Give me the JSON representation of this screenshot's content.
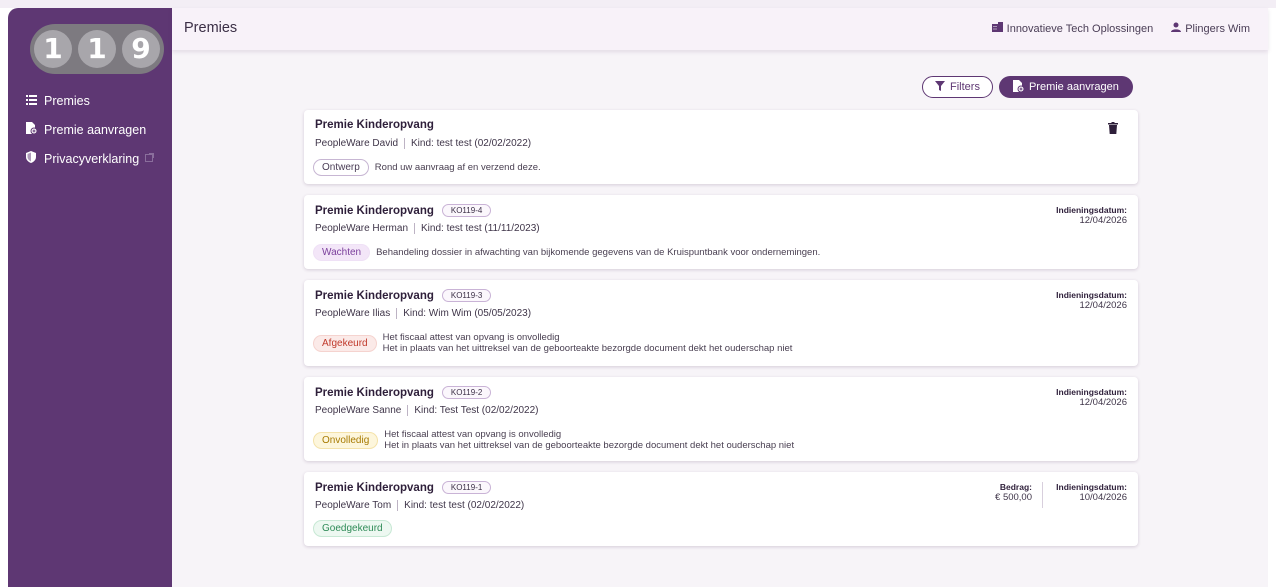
{
  "logo": {
    "digits": [
      "1",
      "1",
      "9"
    ]
  },
  "sidebar": {
    "items": [
      {
        "label": "Premies",
        "icon": "list-icon"
      },
      {
        "label": "Premie aanvragen",
        "icon": "file-add-icon"
      },
      {
        "label": "Privacyverklaring",
        "icon": "shield-icon",
        "external": true
      }
    ]
  },
  "header": {
    "title": "Premies",
    "organization": "Innovatieve Tech Oplossingen",
    "user": "Plingers Wim"
  },
  "actions": {
    "filters_label": "Filters",
    "request_label": "Premie aanvragen"
  },
  "colors": {
    "sidebar": "#5e3773",
    "accent": "#5e3773"
  },
  "cards": [
    {
      "title": "Premie Kinderopvang",
      "person": "PeopleWare David",
      "child": "Kind: test test (02/02/2022)",
      "status": "Ontwerp",
      "messages": [
        "Rond uw aanvraag af en verzend deze."
      ]
    },
    {
      "title": "Premie Kinderopvang",
      "ref": "KO119-4",
      "person": "PeopleWare Herman",
      "child": "Kind: test test (11/11/2023)",
      "status": "Wachten",
      "messages": [
        "Behandeling dossier in afwachting van bijkomende gegevens van de Kruispuntbank voor ondernemingen."
      ],
      "date_label": "Indieningsdatum:",
      "date": "12/04/2026"
    },
    {
      "title": "Premie Kinderopvang",
      "ref": "KO119-3",
      "person": "PeopleWare Ilias",
      "child": "Kind: Wim Wim (05/05/2023)",
      "status": "Afgekeurd",
      "messages": [
        "Het fiscaal attest van opvang is onvolledig",
        "Het in plaats van het uittreksel van de geboorteakte bezorgde document dekt het ouderschap niet"
      ],
      "date_label": "Indieningsdatum:",
      "date": "12/04/2026"
    },
    {
      "title": "Premie Kinderopvang",
      "ref": "KO119-2",
      "person": "PeopleWare Sanne",
      "child": "Kind: Test Test (02/02/2022)",
      "status": "Onvolledig",
      "messages": [
        "Het fiscaal attest van opvang is onvolledig",
        "Het in plaats van het uittreksel van de geboorteakte bezorgde document dekt het ouderschap niet"
      ],
      "date_label": "Indieningsdatum:",
      "date": "12/04/2026"
    },
    {
      "title": "Premie Kinderopvang",
      "ref": "KO119-1",
      "person": "PeopleWare Tom",
      "child": "Kind: test test (02/02/2022)",
      "status": "Goedgekeurd",
      "amount_label": "Bedrag:",
      "amount": "€ 500,00",
      "date_label": "Indieningsdatum:",
      "date": "10/04/2026"
    }
  ]
}
